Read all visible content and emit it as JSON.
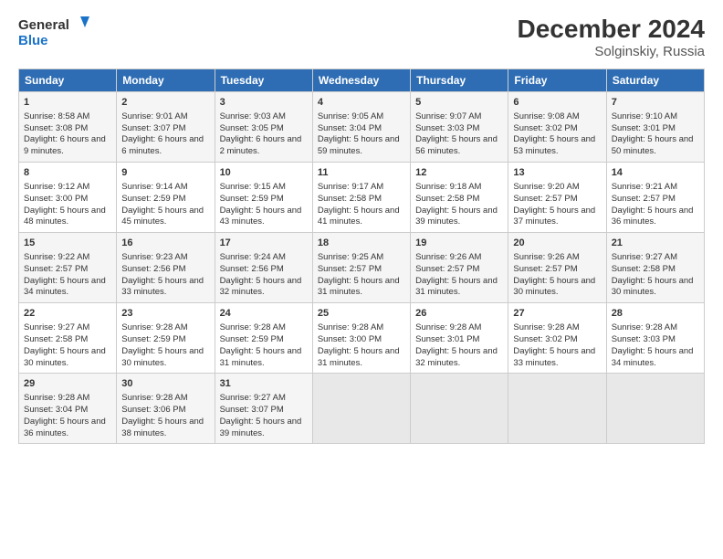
{
  "header": {
    "logo_line1": "General",
    "logo_line2": "Blue",
    "title": "December 2024",
    "subtitle": "Solginskiy, Russia"
  },
  "days_of_week": [
    "Sunday",
    "Monday",
    "Tuesday",
    "Wednesday",
    "Thursday",
    "Friday",
    "Saturday"
  ],
  "weeks": [
    [
      {
        "day": "1",
        "rise": "Sunrise: 8:58 AM",
        "set": "Sunset: 3:08 PM",
        "daylight": "Daylight: 6 hours and 9 minutes."
      },
      {
        "day": "2",
        "rise": "Sunrise: 9:01 AM",
        "set": "Sunset: 3:07 PM",
        "daylight": "Daylight: 6 hours and 6 minutes."
      },
      {
        "day": "3",
        "rise": "Sunrise: 9:03 AM",
        "set": "Sunset: 3:05 PM",
        "daylight": "Daylight: 6 hours and 2 minutes."
      },
      {
        "day": "4",
        "rise": "Sunrise: 9:05 AM",
        "set": "Sunset: 3:04 PM",
        "daylight": "Daylight: 5 hours and 59 minutes."
      },
      {
        "day": "5",
        "rise": "Sunrise: 9:07 AM",
        "set": "Sunset: 3:03 PM",
        "daylight": "Daylight: 5 hours and 56 minutes."
      },
      {
        "day": "6",
        "rise": "Sunrise: 9:08 AM",
        "set": "Sunset: 3:02 PM",
        "daylight": "Daylight: 5 hours and 53 minutes."
      },
      {
        "day": "7",
        "rise": "Sunrise: 9:10 AM",
        "set": "Sunset: 3:01 PM",
        "daylight": "Daylight: 5 hours and 50 minutes."
      }
    ],
    [
      {
        "day": "8",
        "rise": "Sunrise: 9:12 AM",
        "set": "Sunset: 3:00 PM",
        "daylight": "Daylight: 5 hours and 48 minutes."
      },
      {
        "day": "9",
        "rise": "Sunrise: 9:14 AM",
        "set": "Sunset: 2:59 PM",
        "daylight": "Daylight: 5 hours and 45 minutes."
      },
      {
        "day": "10",
        "rise": "Sunrise: 9:15 AM",
        "set": "Sunset: 2:59 PM",
        "daylight": "Daylight: 5 hours and 43 minutes."
      },
      {
        "day": "11",
        "rise": "Sunrise: 9:17 AM",
        "set": "Sunset: 2:58 PM",
        "daylight": "Daylight: 5 hours and 41 minutes."
      },
      {
        "day": "12",
        "rise": "Sunrise: 9:18 AM",
        "set": "Sunset: 2:58 PM",
        "daylight": "Daylight: 5 hours and 39 minutes."
      },
      {
        "day": "13",
        "rise": "Sunrise: 9:20 AM",
        "set": "Sunset: 2:57 PM",
        "daylight": "Daylight: 5 hours and 37 minutes."
      },
      {
        "day": "14",
        "rise": "Sunrise: 9:21 AM",
        "set": "Sunset: 2:57 PM",
        "daylight": "Daylight: 5 hours and 36 minutes."
      }
    ],
    [
      {
        "day": "15",
        "rise": "Sunrise: 9:22 AM",
        "set": "Sunset: 2:57 PM",
        "daylight": "Daylight: 5 hours and 34 minutes."
      },
      {
        "day": "16",
        "rise": "Sunrise: 9:23 AM",
        "set": "Sunset: 2:56 PM",
        "daylight": "Daylight: 5 hours and 33 minutes."
      },
      {
        "day": "17",
        "rise": "Sunrise: 9:24 AM",
        "set": "Sunset: 2:56 PM",
        "daylight": "Daylight: 5 hours and 32 minutes."
      },
      {
        "day": "18",
        "rise": "Sunrise: 9:25 AM",
        "set": "Sunset: 2:57 PM",
        "daylight": "Daylight: 5 hours and 31 minutes."
      },
      {
        "day": "19",
        "rise": "Sunrise: 9:26 AM",
        "set": "Sunset: 2:57 PM",
        "daylight": "Daylight: 5 hours and 31 minutes."
      },
      {
        "day": "20",
        "rise": "Sunrise: 9:26 AM",
        "set": "Sunset: 2:57 PM",
        "daylight": "Daylight: 5 hours and 30 minutes."
      },
      {
        "day": "21",
        "rise": "Sunrise: 9:27 AM",
        "set": "Sunset: 2:58 PM",
        "daylight": "Daylight: 5 hours and 30 minutes."
      }
    ],
    [
      {
        "day": "22",
        "rise": "Sunrise: 9:27 AM",
        "set": "Sunset: 2:58 PM",
        "daylight": "Daylight: 5 hours and 30 minutes."
      },
      {
        "day": "23",
        "rise": "Sunrise: 9:28 AM",
        "set": "Sunset: 2:59 PM",
        "daylight": "Daylight: 5 hours and 30 minutes."
      },
      {
        "day": "24",
        "rise": "Sunrise: 9:28 AM",
        "set": "Sunset: 2:59 PM",
        "daylight": "Daylight: 5 hours and 31 minutes."
      },
      {
        "day": "25",
        "rise": "Sunrise: 9:28 AM",
        "set": "Sunset: 3:00 PM",
        "daylight": "Daylight: 5 hours and 31 minutes."
      },
      {
        "day": "26",
        "rise": "Sunrise: 9:28 AM",
        "set": "Sunset: 3:01 PM",
        "daylight": "Daylight: 5 hours and 32 minutes."
      },
      {
        "day": "27",
        "rise": "Sunrise: 9:28 AM",
        "set": "Sunset: 3:02 PM",
        "daylight": "Daylight: 5 hours and 33 minutes."
      },
      {
        "day": "28",
        "rise": "Sunrise: 9:28 AM",
        "set": "Sunset: 3:03 PM",
        "daylight": "Daylight: 5 hours and 34 minutes."
      }
    ],
    [
      {
        "day": "29",
        "rise": "Sunrise: 9:28 AM",
        "set": "Sunset: 3:04 PM",
        "daylight": "Daylight: 5 hours and 36 minutes."
      },
      {
        "day": "30",
        "rise": "Sunrise: 9:28 AM",
        "set": "Sunset: 3:06 PM",
        "daylight": "Daylight: 5 hours and 38 minutes."
      },
      {
        "day": "31",
        "rise": "Sunrise: 9:27 AM",
        "set": "Sunset: 3:07 PM",
        "daylight": "Daylight: 5 hours and 39 minutes."
      },
      {
        "day": "",
        "rise": "",
        "set": "",
        "daylight": ""
      },
      {
        "day": "",
        "rise": "",
        "set": "",
        "daylight": ""
      },
      {
        "day": "",
        "rise": "",
        "set": "",
        "daylight": ""
      },
      {
        "day": "",
        "rise": "",
        "set": "",
        "daylight": ""
      }
    ]
  ]
}
